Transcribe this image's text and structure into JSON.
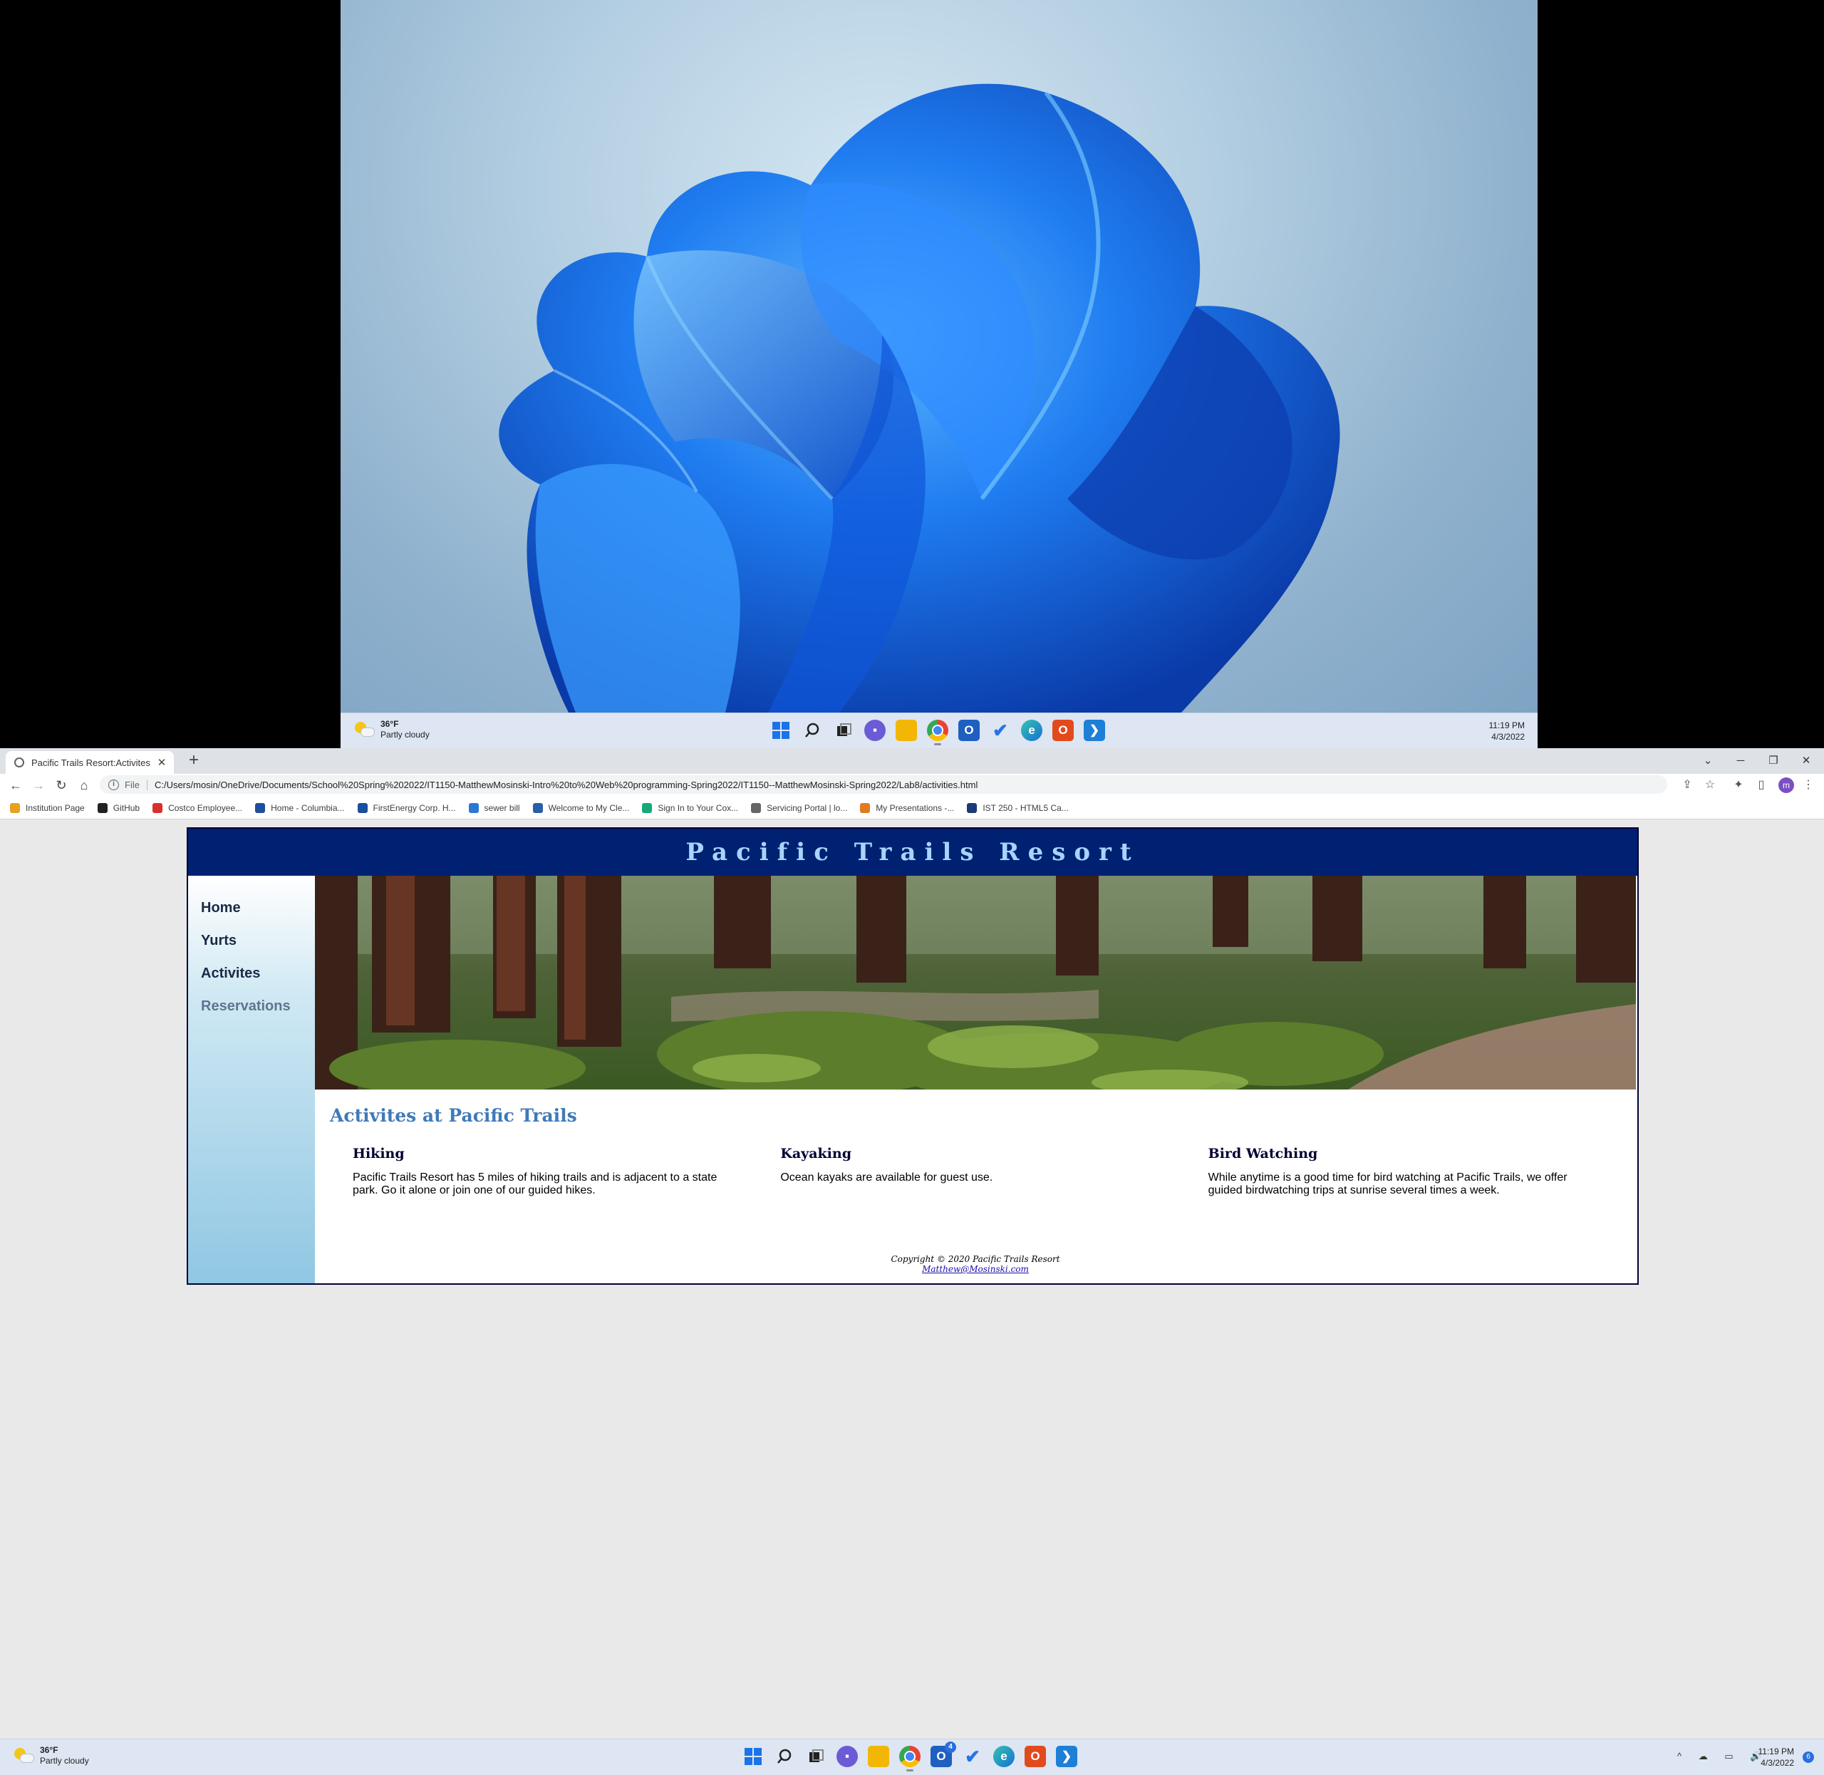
{
  "remote_desktop": {
    "weather": {
      "temp": "36°F",
      "condition": "Partly cloudy"
    },
    "clock": {
      "time": "11:19 PM",
      "date": "4/3/2022"
    }
  },
  "browser": {
    "tab": {
      "title": "Pacific Trails Resort:Activites",
      "close": "✕"
    },
    "new_tab": "+",
    "window_controls": [
      "⌄",
      "─",
      "❐",
      "✕"
    ],
    "address": {
      "scheme": "File",
      "url": "C:/Users/mosin/OneDrive/Documents/School%20Spring%202022/IT1150-MatthewMosinski-Intro%20to%20Web%20programming-Spring2022/IT1150--MatthewMosinski-Spring2022/Lab8/activities.html"
    },
    "profile_initial": "m",
    "bookmarks": [
      {
        "label": "Institution Page",
        "color": "#e8a01e"
      },
      {
        "label": "GitHub",
        "color": "#222222"
      },
      {
        "label": "Costco Employee...",
        "color": "#d9302c"
      },
      {
        "label": "Home - Columbia...",
        "color": "#1f4e9c"
      },
      {
        "label": "FirstEnergy Corp. H...",
        "color": "#1a4e9e"
      },
      {
        "label": "sewer bill",
        "color": "#2a78d4"
      },
      {
        "label": "Welcome to My Cle...",
        "color": "#2a5ea8"
      },
      {
        "label": "Sign In to Your Cox...",
        "color": "#17a87a"
      },
      {
        "label": "Servicing Portal | lo...",
        "color": "#666666"
      },
      {
        "label": "My Presentations -...",
        "color": "#e27b1f"
      },
      {
        "label": "IST 250 - HTML5 Ca...",
        "color": "#1c3a7a"
      }
    ]
  },
  "page": {
    "site_title": "Pacific Trails Resort",
    "nav": [
      {
        "label": "Home"
      },
      {
        "label": "Yurts"
      },
      {
        "label": "Activites"
      },
      {
        "label": "Reservations"
      }
    ],
    "heading": "Activites at Pacific Trails",
    "activities": [
      {
        "title": "Hiking",
        "text": "Pacific Trails Resort has 5 miles of hiking trails and is adjacent to a state park. Go it alone or join one of our guided hikes."
      },
      {
        "title": "Kayaking",
        "text": "Ocean kayaks are available for guest use."
      },
      {
        "title": "Bird Watching",
        "text": "While anytime is a good time for bird watching at Pacific Trails, we offer guided birdwatching trips at sunrise several times a week."
      }
    ],
    "footer": {
      "copyright": "Copyright © 2020 Pacific Trails Resort",
      "email": "Matthew@Mosinski.com"
    }
  },
  "taskbar": {
    "weather": {
      "temp": "36°F",
      "condition": "Partly cloudy"
    },
    "clock": {
      "time": "11:19 PM",
      "date": "4/3/2022"
    },
    "teams_badge": "4",
    "notification_count": "6",
    "tray_icons": "^ ☁ ▭ 🔊"
  }
}
